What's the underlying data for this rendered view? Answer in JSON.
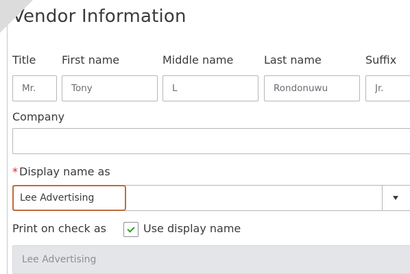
{
  "dialog": {
    "title": "Vendor Information"
  },
  "name_fields": {
    "title": {
      "label": "Title",
      "value": "Mr."
    },
    "first_name": {
      "label": "First name",
      "value": "Tony"
    },
    "middle_name": {
      "label": "Middle name",
      "value": "L"
    },
    "last_name": {
      "label": "Last name",
      "value": "Rondonuwu"
    },
    "suffix": {
      "label": "Suffix",
      "value": "Jr."
    }
  },
  "company": {
    "label": "Company",
    "value": ""
  },
  "display_name": {
    "required_marker": "*",
    "label": "Display name as",
    "value": "Lee Advertising",
    "dropdown_icon": "chevron-down-icon",
    "highlight_color": "#c06b3e"
  },
  "print_on_check": {
    "label": "Print on check as",
    "checkbox_checked": true,
    "checkbox_label": "Use display name",
    "value": "Lee Advertising",
    "check_color": "#2ca01c"
  }
}
